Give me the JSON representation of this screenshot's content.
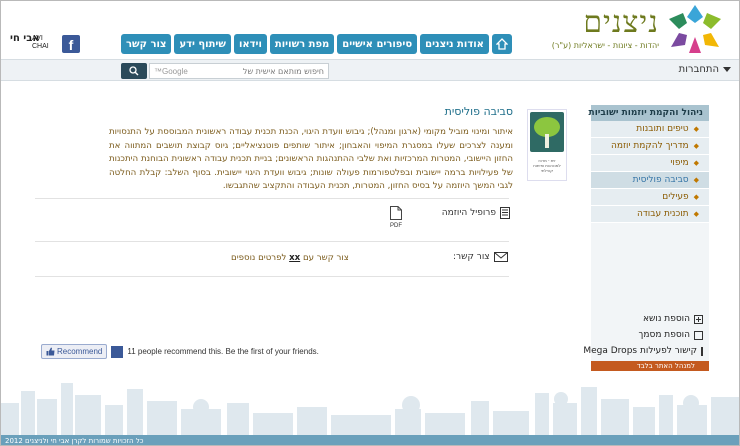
{
  "brand": {
    "title": "ניצנים",
    "tagline": "יהדות - ציונות - ישראליות (ע\"ר)"
  },
  "nav": {
    "items": [
      "אודות ניצנים",
      "סיפורים אישיים",
      "מפת רשויות",
      "וידאו",
      "שיתוף ידע",
      "צור קשר"
    ]
  },
  "partner": {
    "logo_he": "אבי חי",
    "logo_en": "AVI CHAI",
    "facebook": "f"
  },
  "search": {
    "placeholder": "חיפוש מותאם אישית של",
    "provider": "Google™"
  },
  "login": {
    "label": "התחברות"
  },
  "sidebar": {
    "title": "ניהול והקמת יוזמות ישוביות",
    "items": [
      {
        "label": "טיפים ותובנות",
        "active": false
      },
      {
        "label": "מדריך להקמת יוזמה",
        "active": false
      },
      {
        "label": "מיפוי",
        "active": false
      },
      {
        "label": "סביבה פוליסית",
        "active": true
      },
      {
        "label": "פעילים",
        "active": false
      },
      {
        "label": "תוכנית עבודה",
        "active": false
      }
    ],
    "tools": [
      {
        "label": "הוספת נושא",
        "icon": "plus-icon"
      },
      {
        "label": "הוספת מסמך",
        "icon": "document-icon"
      },
      {
        "label": "קישור לפעילות Mega Drops",
        "icon": "link-icon"
      }
    ],
    "admin": "למנהל האתר בלבד"
  },
  "badge": {
    "caption": "זית - מרכז למנהיגות ופיתוח קהילתי"
  },
  "main": {
    "title": "סביבה פוליסית",
    "paragraph": "איתור ומינוי מוביל מקומי (ארגון ומנהל); גיבוש וועדת היגוי, הכנת תכנית עבודה ראשונית המבוססת על התנסויות ומענה לצרכים שעלו במסגרת המיפוי והאבחון; איתור שותפים פוטנציאליים; גיוס קבוצת תושבים המתווה את החזון היישובי, המטרות המרכזיות ואת שלבי ההתנהגות הראשונים; בניית תכנית עבודה ראשונית הבוחנת היתכנות של פעילויות ברמה יישובית ובפלטפורמות פעולה שונות; גיבוש וועדת היגוי יישובית. בסוף השלב: קבלת החלטה לגבי המשך היוזמה על בסיס החזון, המטרות, תכנית העבודה והתקציב שהתגבשו.",
    "profile_label": "פרופיל היוזמה",
    "pdf_label": "PDF",
    "contact_label": "צור קשר:",
    "contact_prefix": "צור קשר עם",
    "contact_link": "xx",
    "contact_suffix": "לפרטים נוספים"
  },
  "social": {
    "recommend_label": "Recommend",
    "recommend_text": "11 people recommend this. Be the first of your friends."
  },
  "footer": {
    "text": "כל הזכויות שמורות לקרן אבי חי ולניצנים 2012"
  }
}
